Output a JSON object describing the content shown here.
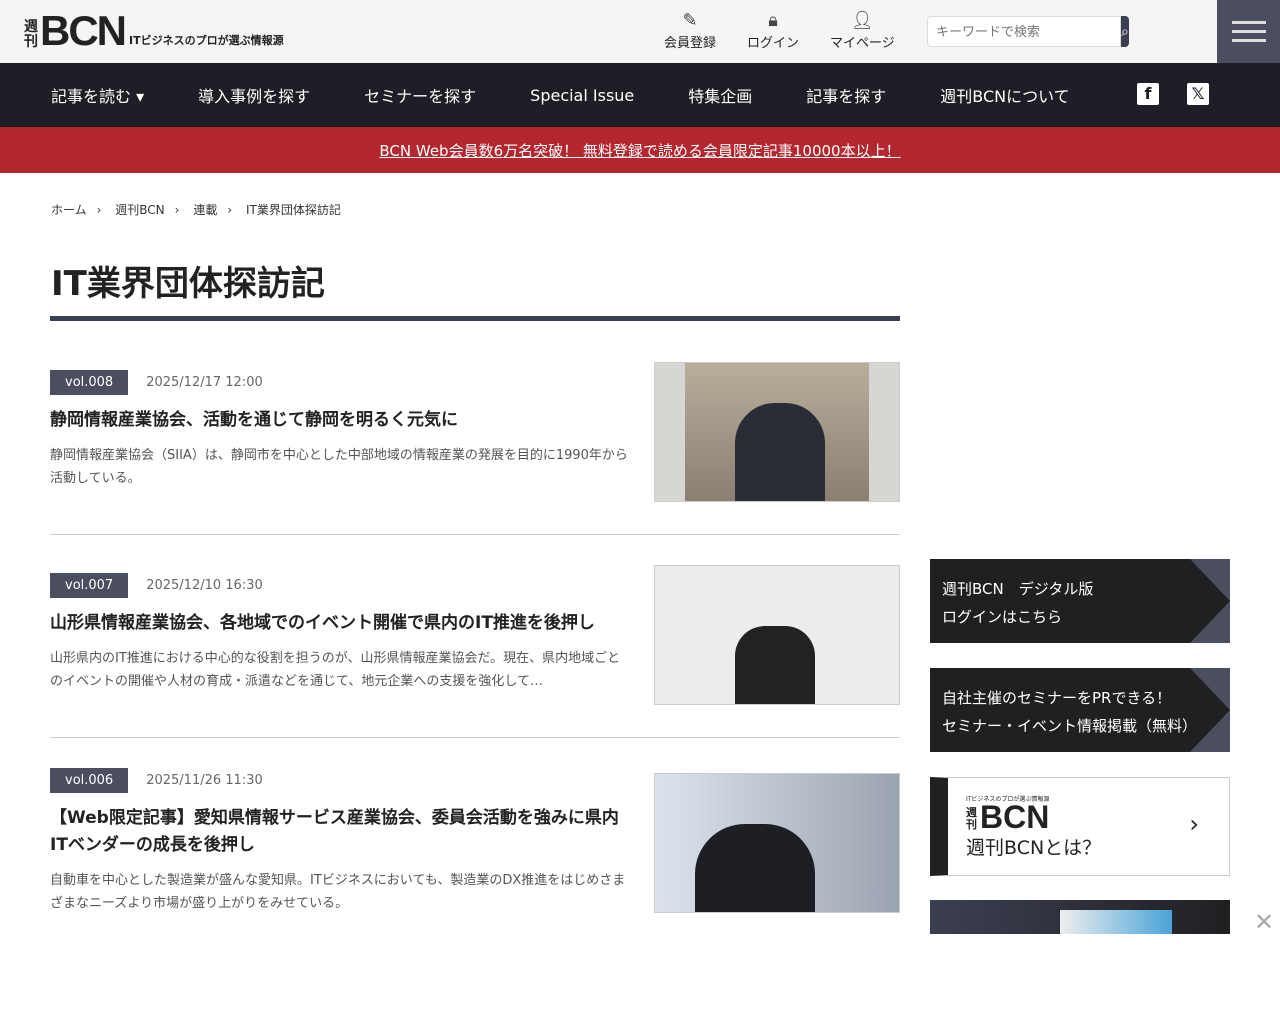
{
  "header": {
    "logo_small": "週刊",
    "logo_big": "BCN",
    "logo_tagline": "ITビジネスのプロが選ぶ情報源",
    "register": "会員登録",
    "login": "ログイン",
    "mypage": "マイページ",
    "search_placeholder": "キーワードで検索"
  },
  "nav": [
    "記事を読む ▾",
    "導入事例を探す",
    "セミナーを探す",
    "Special Issue",
    "特集企画",
    "記事を探す",
    "週刊BCNについて"
  ],
  "banner": "BCN Web会員数6万名突破！ 無料登録で読める会員限定記事10000本以上！",
  "breadcrumb": [
    "ホーム",
    "週刊BCN",
    "連載",
    "IT業界団体探訪記"
  ],
  "page_title": "IT業界団体探訪記",
  "articles": [
    {
      "vol": "vol.008",
      "date": "2025/12/17 12:00",
      "title": "静岡情報産業協会、活動を通じて静岡を明るく元気に",
      "desc": "静岡情報産業協会（SIIA）は、静岡市を中心とした中部地域の情報産業の発展を目的に1990年から活動している。"
    },
    {
      "vol": "vol.007",
      "date": "2025/12/10 16:30",
      "title": "山形県情報産業協会、各地域でのイベント開催で県内のIT推進を後押し",
      "desc": "山形県内のIT推進における中心的な役割を担うのが、山形県情報産業協会だ。現在、県内地域ごとのイベントの開催や人材の育成・派遣などを通じて、地元企業への支援を強化して…"
    },
    {
      "vol": "vol.006",
      "date": "2025/11/26 11:30",
      "title": "【Web限定記事】愛知県情報サービス産業協会、委員会活動を強みに県内ITベンダーの成長を後押し",
      "desc": "自動車を中心とした製造業が盛んな愛知県。ITビジネスにおいても、製造業のDX推進をはじめさまざまなニーズより市場が盛り上がりをみせている。"
    }
  ],
  "sidebar": {
    "digital_1": "週刊BCN　デジタル版",
    "digital_2": "ログインはこちら",
    "seminar_1": "自社主催のセミナーをPRできる！",
    "seminar_2": "セミナー・イベント情報掲載（無料）",
    "about": "週刊BCNとは？"
  }
}
